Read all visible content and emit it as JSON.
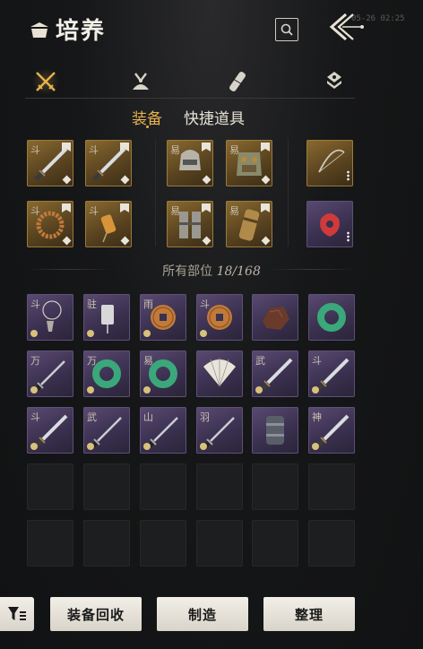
{
  "header": {
    "title": "培养",
    "timestamp": "05-26 02:25"
  },
  "sub_tabs": {
    "equipment": "装备",
    "quick_items": "快捷道具"
  },
  "equipped": {
    "row1": [
      {
        "label": "斗",
        "item": "blade",
        "rarity": "gold"
      },
      {
        "label": "斗",
        "item": "blade",
        "rarity": "gold"
      },
      {
        "label": "易",
        "item": "armor-head",
        "rarity": "gold"
      },
      {
        "label": "易",
        "item": "armor-chest",
        "rarity": "gold"
      },
      {
        "label": "",
        "item": "bow",
        "rarity": "gold"
      }
    ],
    "row2": [
      {
        "label": "斗",
        "item": "bead-bracelet",
        "rarity": "gold"
      },
      {
        "label": "斗",
        "item": "talisman",
        "rarity": "gold"
      },
      {
        "label": "易",
        "item": "armor-legs",
        "rarity": "gold"
      },
      {
        "label": "易",
        "item": "armor-arm",
        "rarity": "gold"
      },
      {
        "label": "",
        "item": "red-charm",
        "rarity": "purple"
      }
    ]
  },
  "inventory": {
    "label": "所有部位",
    "count": "18/168",
    "rows": [
      [
        {
          "label": "斗",
          "item": "pendant",
          "rarity": "purple"
        },
        {
          "label": "驻",
          "item": "seal",
          "rarity": "purple"
        },
        {
          "label": "雨",
          "item": "coin",
          "rarity": "purple"
        },
        {
          "label": "斗",
          "item": "coin",
          "rarity": "purple"
        },
        {
          "label": "",
          "item": "ore",
          "rarity": "purple"
        },
        {
          "label": "",
          "item": "jade-ring",
          "rarity": "purple"
        }
      ],
      [
        {
          "label": "万",
          "item": "sword",
          "rarity": "purple"
        },
        {
          "label": "万",
          "item": "jade-ring",
          "rarity": "purple"
        },
        {
          "label": "易",
          "item": "jade-ring",
          "rarity": "purple"
        },
        {
          "label": "",
          "item": "fan",
          "rarity": "purple"
        },
        {
          "label": "武",
          "item": "blade",
          "rarity": "purple"
        },
        {
          "label": "斗",
          "item": "blade",
          "rarity": "purple"
        }
      ],
      [
        {
          "label": "斗",
          "item": "blade",
          "rarity": "purple"
        },
        {
          "label": "武",
          "item": "sword",
          "rarity": "purple"
        },
        {
          "label": "山",
          "item": "sword",
          "rarity": "purple"
        },
        {
          "label": "羽",
          "item": "sword",
          "rarity": "purple"
        },
        {
          "label": "",
          "item": "bracer",
          "rarity": "purple"
        },
        {
          "label": "神",
          "item": "blade",
          "rarity": "purple"
        }
      ]
    ],
    "empty_rows": 2
  },
  "buttons": {
    "recycle": "装备回收",
    "craft": "制造",
    "sort": "整理"
  },
  "colors": {
    "accent": "#e8b24c",
    "gold_slot": "#7a5c2a",
    "purple_slot": "#4a3d60"
  }
}
